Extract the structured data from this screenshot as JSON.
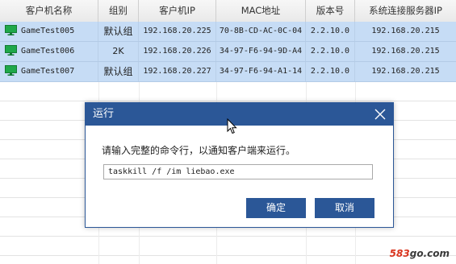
{
  "table": {
    "columns": [
      "客户机名称",
      "组别",
      "客户机IP",
      "MAC地址",
      "版本号",
      "系统连接服务器IP"
    ],
    "rows": [
      {
        "name": "GameTest005",
        "group": "默认组",
        "ip": "192.168.20.225",
        "mac": "70-8B-CD-AC-0C-04",
        "version": "2.2.10.0",
        "server_ip": "192.168.20.215"
      },
      {
        "name": "GameTest006",
        "group": "2K",
        "ip": "192.168.20.226",
        "mac": "34-97-F6-94-9D-A4",
        "version": "2.2.10.0",
        "server_ip": "192.168.20.215"
      },
      {
        "name": "GameTest007",
        "group": "默认组",
        "ip": "192.168.20.227",
        "mac": "34-97-F6-94-A1-14",
        "version": "2.2.10.0",
        "server_ip": "192.168.20.215"
      }
    ]
  },
  "dialog": {
    "title": "运行",
    "prompt": "请输入完整的命令行，以通知客户端来运行。",
    "command_value": "taskkill /f /im liebao.exe",
    "ok_label": "确定",
    "cancel_label": "取消"
  },
  "watermark": {
    "num": "583",
    "dom": "go.com"
  },
  "colors": {
    "selection": "#c6dcf5",
    "dialog_accent": "#2b5797",
    "monitor_icon": "#1fa84a"
  },
  "icons": {
    "row_icon": "monitor-icon",
    "close": "close-icon",
    "cursor": "mouse-cursor-icon"
  }
}
